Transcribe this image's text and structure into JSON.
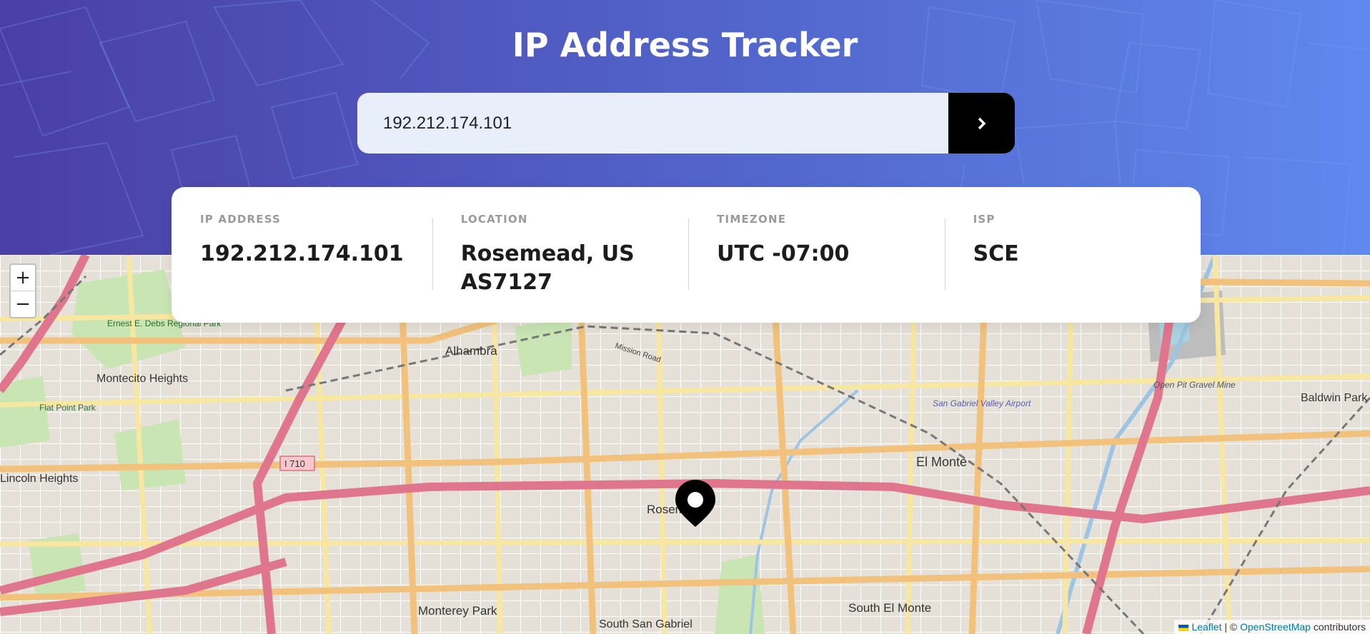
{
  "header": {
    "title": "IP Address Tracker"
  },
  "search": {
    "value": "192.212.174.101",
    "button_icon": "chevron-right-icon"
  },
  "info": {
    "ip_label": "IP ADDRESS",
    "ip_value": "192.212.174.101",
    "location_label": "LOCATION",
    "location_value_line1": "Rosemead, US",
    "location_value_line2": "AS7127",
    "timezone_label": "TIMEZONE",
    "timezone_value": "UTC -07:00",
    "isp_label": "ISP",
    "isp_value": "SCE"
  },
  "map": {
    "zoom_in": "+",
    "zoom_out": "−",
    "marker_icon": "location-pin-icon",
    "places": {
      "alhambra": "Alhambra",
      "montecito_heights": "Montecito Heights",
      "ernest_debs": "Ernest E. Debs Regional Park",
      "flat_point_park": "Flat Point Park",
      "lincoln_heights": "Lincoln Heights",
      "el_monte": "El Monte",
      "rosemead": "Rosem",
      "monterey_park": "Monterey Park",
      "south_san_gabriel": "South San Gabriel",
      "south_el_monte": "South El Monte",
      "baldwin_park": "Baldwin Park",
      "open_pit": "Open Pit Gravel Mine",
      "airport": "San Gabriel Valley Airport",
      "mission_road": "Mission Road",
      "i710": "I 710"
    }
  },
  "attribution": {
    "leaflet": "Leaflet",
    "sep": "| ©",
    "osm": "OpenStreetMap",
    "contributors": "contributors"
  },
  "colors": {
    "accent_dark": "#4a3fa6",
    "accent_light": "#6088ee",
    "button_bg": "#000000"
  }
}
